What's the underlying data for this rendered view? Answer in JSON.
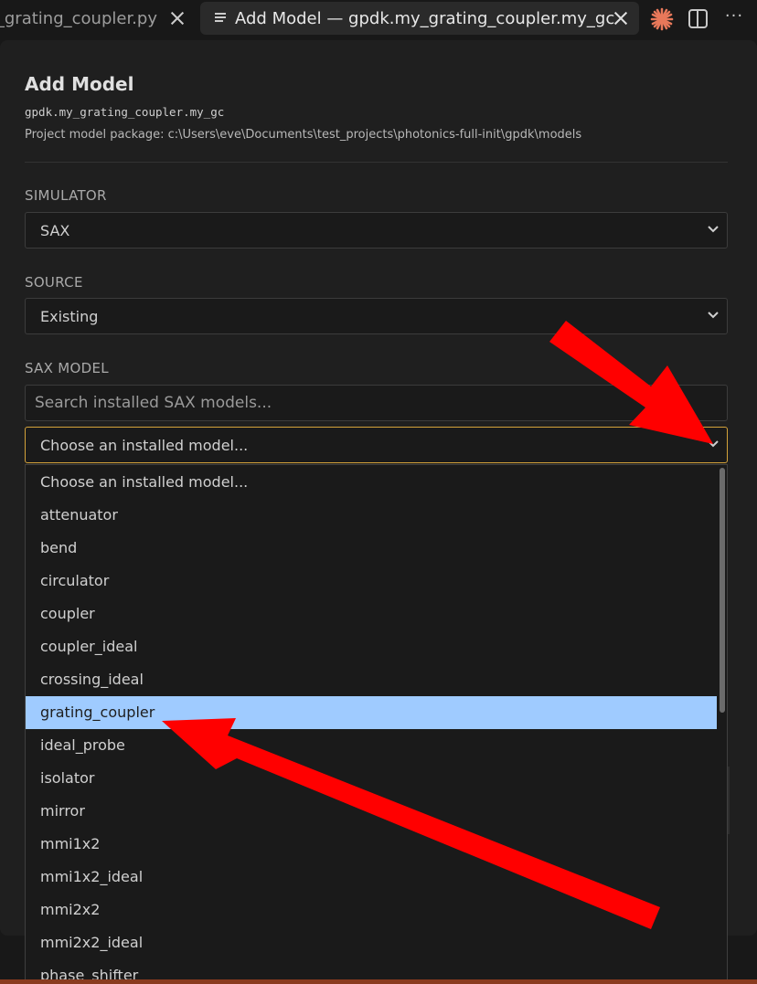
{
  "tabs": {
    "previous": {
      "label": "y_grating_coupler.py"
    },
    "active": {
      "label": "Add Model — gpdk.my_grating_coupler.my_gc"
    }
  },
  "panel": {
    "title": "Add Model",
    "model_id": "gpdk.my_grating_coupler.my_gc",
    "package_path": "Project model package: c:\\Users\\eve\\Documents\\test_projects\\photonics-full-init\\gpdk\\models"
  },
  "simulator": {
    "label": "SIMULATOR",
    "value": "SAX"
  },
  "source": {
    "label": "SOURCE",
    "value": "Existing"
  },
  "sax_model": {
    "label": "SAX MODEL",
    "search_placeholder": "Search installed SAX models...",
    "selected_value": "Choose an installed model...",
    "options": [
      "Choose an installed model...",
      "attenuator",
      "bend",
      "circulator",
      "coupler",
      "coupler_ideal",
      "crossing_ideal",
      "grating_coupler",
      "ideal_probe",
      "isolator",
      "mirror",
      "mmi1x2",
      "mmi1x2_ideal",
      "mmi2x2",
      "mmi2x2_ideal",
      "phase_shifter"
    ],
    "highlighted_index": 7
  },
  "colors": {
    "accent_focus": "#d4a23a",
    "highlight": "#9fcbff",
    "annotation_arrow": "#ff0000",
    "spark_icon": "#e8785a"
  },
  "icons": [
    "doc-icon",
    "close-icon",
    "spark-icon",
    "split-editor-icon",
    "more-icon",
    "chevron-down-icon"
  ]
}
